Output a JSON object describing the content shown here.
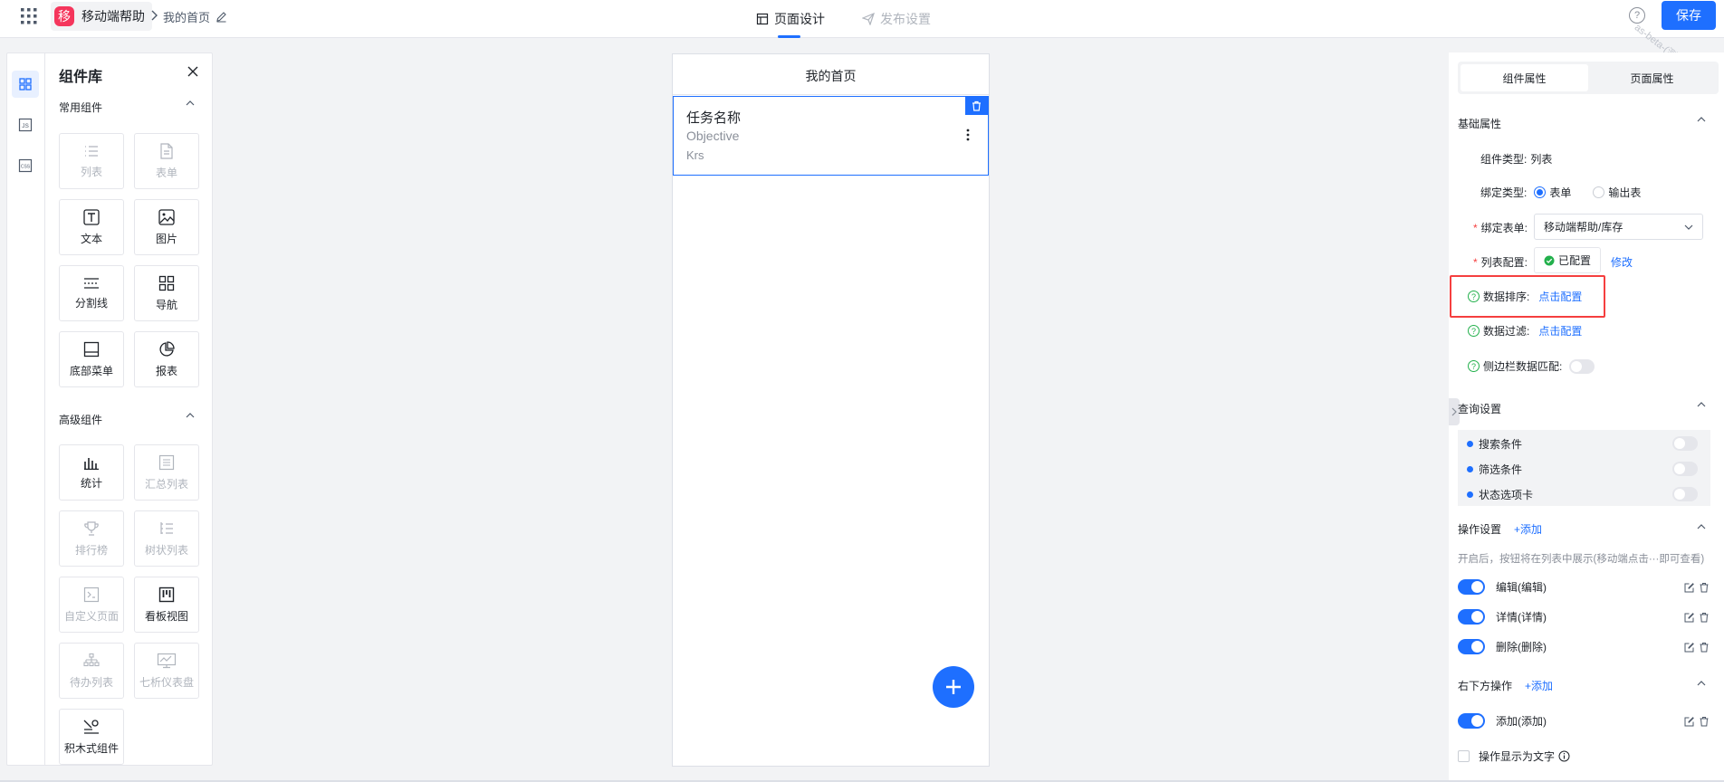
{
  "app": {
    "logo_char": "移",
    "name": "移动端帮助",
    "page": "我的首页"
  },
  "top_tabs": {
    "design": "页面设计",
    "publish": "发布设置"
  },
  "save_label": "保存",
  "help_glyph": "?",
  "watermark": "as-beta-(测试环境)",
  "left_rail": {
    "code_js": "JS",
    "code_css": "CSS"
  },
  "library": {
    "title": "组件库",
    "common_title": "常用组件",
    "common": [
      "列表",
      "表单",
      "文本",
      "图片",
      "分割线",
      "导航",
      "底部菜单",
      "报表"
    ],
    "advanced_title": "高级组件",
    "advanced": [
      "统计",
      "汇总列表",
      "排行榜",
      "树状列表",
      "自定义页面",
      "看板视图",
      "待办列表",
      "七析仪表盘",
      "积木式组件"
    ]
  },
  "canvas": {
    "title": "我的首页",
    "card": {
      "title": "任务名称",
      "line2": "Objective",
      "line3": "Krs"
    }
  },
  "right": {
    "tabs": [
      "组件属性",
      "页面属性"
    ],
    "basic": {
      "title": "基础属性",
      "type_label": "组件类型:",
      "type_value": "列表",
      "bind_type_label": "绑定类型:",
      "bind_opt1": "表单",
      "bind_opt2": "输出表",
      "bind_form_label": "绑定表单:",
      "bind_form_value": "移动端帮助/库存",
      "list_cfg_label": "列表配置:",
      "list_cfg_status": "已配置",
      "list_cfg_edit": "修改",
      "sort_label": "数据排序:",
      "sort_link": "点击配置",
      "filter_label": "数据过滤:",
      "filter_link": "点击配置",
      "sidebar_match_label": "侧边栏数据匹配:"
    },
    "query": {
      "title": "查询设置",
      "items": [
        "搜索条件",
        "筛选条件",
        "状态选项卡"
      ]
    },
    "ops": {
      "title": "操作设置",
      "add": "+添加",
      "hint": "开启后，按钮将在列表中展示(移动端点击···即可查看)",
      "items": [
        "编辑(编辑)",
        "详情(详情)",
        "删除(删除)"
      ]
    },
    "br_ops": {
      "title": "右下方操作",
      "add": "+添加",
      "items": [
        "添加(添加)"
      ]
    },
    "show_as_text": "操作显示为文字"
  },
  "colors": {
    "accent": "#1e6fff",
    "logo": "#f5365c",
    "highlight": "#f53f3f"
  }
}
